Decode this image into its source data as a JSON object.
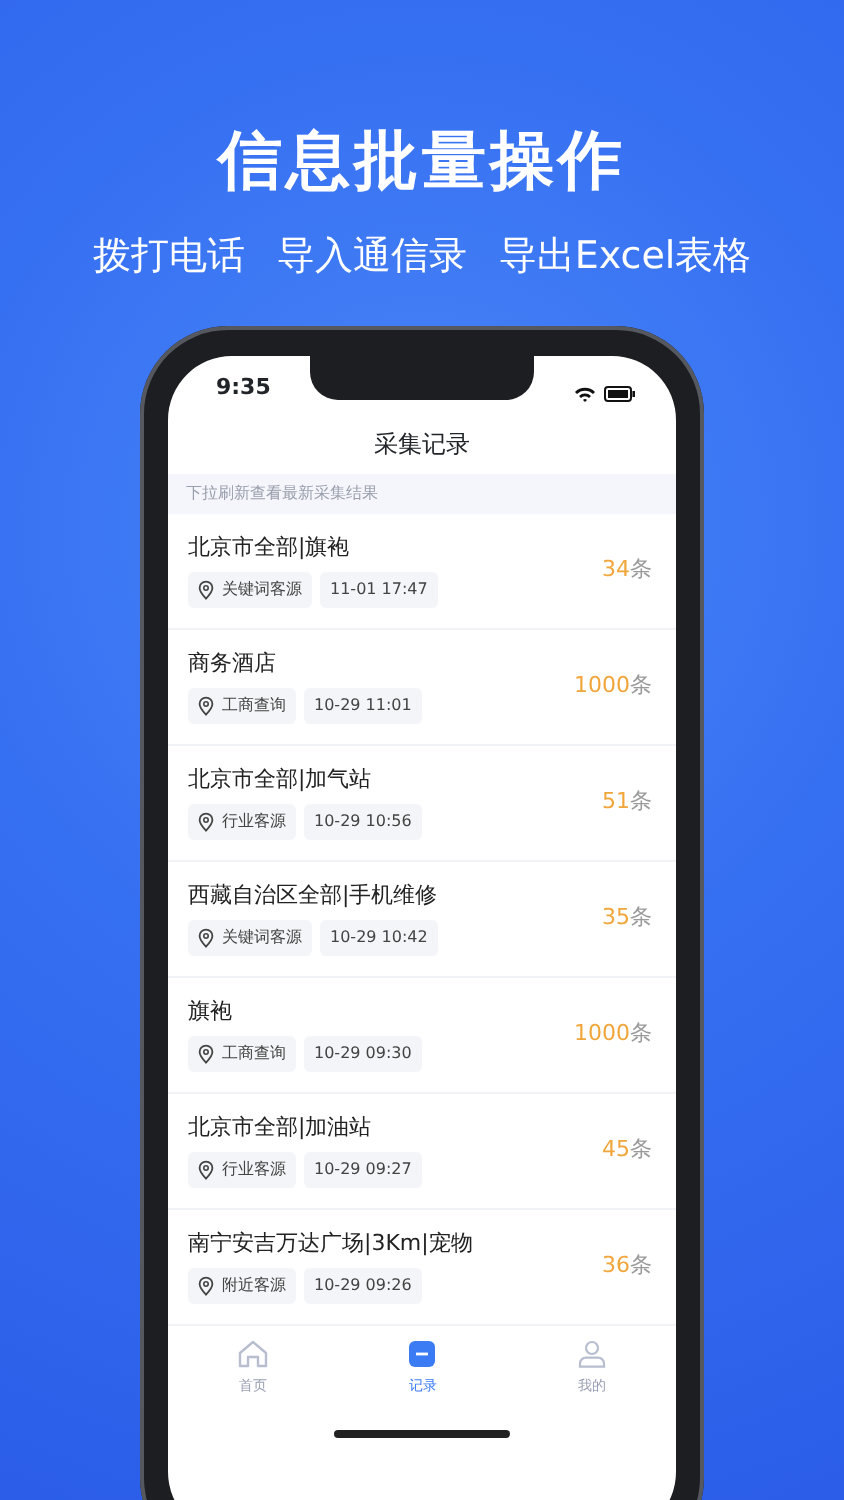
{
  "headline": "信息批量操作",
  "features": [
    "拨打电话",
    "导入通信录",
    "导出Excel表格"
  ],
  "status_bar": {
    "time": "9:35"
  },
  "screen_title": "采集记录",
  "hint": "下拉刷新查看最新采集结果",
  "records": [
    {
      "title": "北京市全部|旗袍",
      "source": "关键词客源",
      "time": "11-01 17:47",
      "count": "34",
      "unit": "条"
    },
    {
      "title": "商务酒店",
      "source": "工商查询",
      "time": "10-29 11:01",
      "count": "1000",
      "unit": "条"
    },
    {
      "title": "北京市全部|加气站",
      "source": "行业客源",
      "time": "10-29 10:56",
      "count": "51",
      "unit": "条"
    },
    {
      "title": "西藏自治区全部|手机维修",
      "source": "关键词客源",
      "time": "10-29 10:42",
      "count": "35",
      "unit": "条"
    },
    {
      "title": "旗袍",
      "source": "工商查询",
      "time": "10-29 09:30",
      "count": "1000",
      "unit": "条"
    },
    {
      "title": "北京市全部|加油站",
      "source": "行业客源",
      "time": "10-29 09:27",
      "count": "45",
      "unit": "条"
    },
    {
      "title": "南宁安吉万达广场|3Km|宠物",
      "source": "附近客源",
      "time": "10-29 09:26",
      "count": "36",
      "unit": "条"
    }
  ],
  "tabs": [
    {
      "kind": "home",
      "label": "首页",
      "selected": false
    },
    {
      "kind": "records",
      "label": "记录",
      "selected": true
    },
    {
      "kind": "profile",
      "label": "我的",
      "selected": false
    }
  ]
}
